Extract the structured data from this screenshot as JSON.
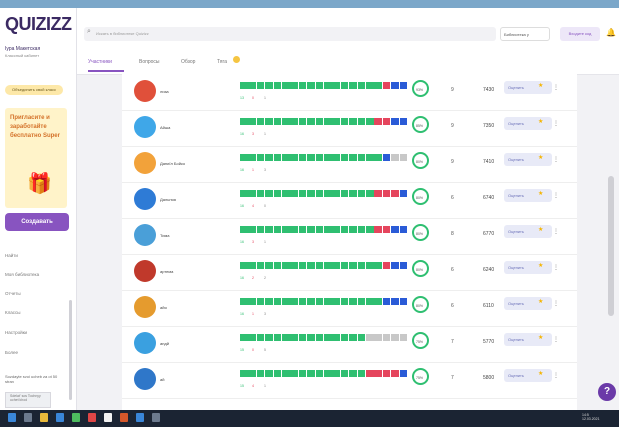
{
  "app": {
    "logo": "QUIZIZZ"
  },
  "sidebar": {
    "user_name": "Іура Макетская",
    "school": "Классный кабинет",
    "school_btn": "Объединить свой класс",
    "promo_text": "Пригласите и заработайте бесплатно Super",
    "create_btn": "Создавать",
    "nav": [
      "Найти",
      "Моя библиотека",
      "Отчеты",
      "Классы",
      "Настройки",
      "Более"
    ],
    "footer_text": "Sozdayte svoi ucheb za ot 50 stran",
    "thumb_text": "Sdelat' sos Tochnyy uchet khod"
  },
  "topbar": {
    "search_placeholder": "Искать в библиотеке Quizizz",
    "library_select": "Библиотека у",
    "enter_code": "Входите код"
  },
  "tabs": [
    {
      "label": "Участники",
      "active": true
    },
    {
      "label": "Вопросы",
      "active": false
    },
    {
      "label": "Обзор",
      "active": false
    },
    {
      "label": "Тяга",
      "active": false
    }
  ],
  "rows": [
    {
      "name": "лиза",
      "avatar_color": "#e0503a",
      "accuracy": "93%",
      "rank": "9",
      "score": "7430",
      "btn": "Оценить",
      "correct": "13",
      "incorrect": "0",
      "skipped": "1",
      "bar": [
        "g",
        "g",
        "g",
        "g",
        "g",
        "g",
        "g",
        "g",
        "g",
        "g",
        "g",
        "g",
        "g",
        "g",
        "g",
        "g",
        "g",
        "r",
        "b",
        "b"
      ]
    },
    {
      "name": "Айша",
      "avatar_color": "#3fa7e8",
      "accuracy": "85%",
      "rank": "9",
      "score": "7350",
      "btn": "Оценить",
      "correct": "16",
      "incorrect": "3",
      "skipped": "1",
      "bar": [
        "g",
        "g",
        "g",
        "g",
        "g",
        "g",
        "g",
        "g",
        "g",
        "g",
        "g",
        "g",
        "g",
        "g",
        "g",
        "g",
        "r",
        "r",
        "b",
        "b"
      ]
    },
    {
      "name": "Даниїл Бойко",
      "avatar_color": "#f2a23a",
      "accuracy": "80%",
      "rank": "9",
      "score": "7410",
      "btn": "Оценить",
      "correct": "16",
      "incorrect": "1",
      "skipped": "3",
      "bar": [
        "g",
        "g",
        "g",
        "g",
        "g",
        "g",
        "g",
        "g",
        "g",
        "g",
        "g",
        "g",
        "g",
        "g",
        "g",
        "g",
        "g",
        "b",
        "x",
        "x"
      ]
    },
    {
      "name": "Дальняя",
      "avatar_color": "#2e7bd6",
      "accuracy": "80%",
      "rank": "6",
      "score": "6740",
      "btn": "Оценить",
      "correct": "16",
      "incorrect": "4",
      "skipped": "0",
      "bar": [
        "g",
        "g",
        "g",
        "g",
        "g",
        "g",
        "g",
        "g",
        "g",
        "g",
        "g",
        "g",
        "g",
        "g",
        "g",
        "g",
        "r",
        "r",
        "r",
        "b"
      ]
    },
    {
      "name": "Тима",
      "avatar_color": "#4a9fd8",
      "accuracy": "80%",
      "rank": "8",
      "score": "6770",
      "btn": "Оценить",
      "correct": "16",
      "incorrect": "3",
      "skipped": "1",
      "bar": [
        "g",
        "g",
        "g",
        "g",
        "g",
        "g",
        "g",
        "g",
        "g",
        "g",
        "g",
        "g",
        "g",
        "g",
        "g",
        "g",
        "r",
        "r",
        "b",
        "b"
      ]
    },
    {
      "name": "артема",
      "avatar_color": "#c0392b",
      "accuracy": "80%",
      "rank": "6",
      "score": "6240",
      "btn": "Оценить",
      "correct": "16",
      "incorrect": "2",
      "skipped": "2",
      "bar": [
        "g",
        "g",
        "g",
        "g",
        "g",
        "g",
        "g",
        "g",
        "g",
        "g",
        "g",
        "g",
        "g",
        "g",
        "g",
        "g",
        "g",
        "r",
        "b",
        "b"
      ]
    },
    {
      "name": "айя",
      "avatar_color": "#e59b2e",
      "accuracy": "80%",
      "rank": "6",
      "score": "6110",
      "btn": "Оценить",
      "correct": "16",
      "incorrect": "1",
      "skipped": "3",
      "bar": [
        "g",
        "g",
        "g",
        "g",
        "g",
        "g",
        "g",
        "g",
        "g",
        "g",
        "g",
        "g",
        "g",
        "g",
        "g",
        "g",
        "g",
        "b",
        "b",
        "b"
      ]
    },
    {
      "name": "андй",
      "avatar_color": "#3aa0e0",
      "accuracy": "75%",
      "rank": "7",
      "score": "5770",
      "btn": "Оценить",
      "correct": "15",
      "incorrect": "0",
      "skipped": "5",
      "bar": [
        "g",
        "g",
        "g",
        "g",
        "g",
        "g",
        "g",
        "g",
        "g",
        "g",
        "g",
        "g",
        "g",
        "g",
        "g",
        "x",
        "x",
        "x",
        "x",
        "x"
      ]
    },
    {
      "name": "ай",
      "avatar_color": "#2f77c9",
      "accuracy": "75%",
      "rank": "7",
      "score": "5800",
      "btn": "Оценить",
      "correct": "15",
      "incorrect": "4",
      "skipped": "1",
      "bar": [
        "g",
        "g",
        "g",
        "g",
        "g",
        "g",
        "g",
        "g",
        "g",
        "g",
        "g",
        "g",
        "g",
        "g",
        "g",
        "r",
        "r",
        "r",
        "r",
        "b"
      ]
    }
  ],
  "colors": {
    "correct": "#2fbf71",
    "incorrect": "#e5455d",
    "partial": "#2a5bd7",
    "skipped": "#c8c8c8",
    "accent": "#8854c0"
  },
  "help_label": "?",
  "taskbar": {
    "time": "14:5",
    "date": "12.03.2021"
  }
}
